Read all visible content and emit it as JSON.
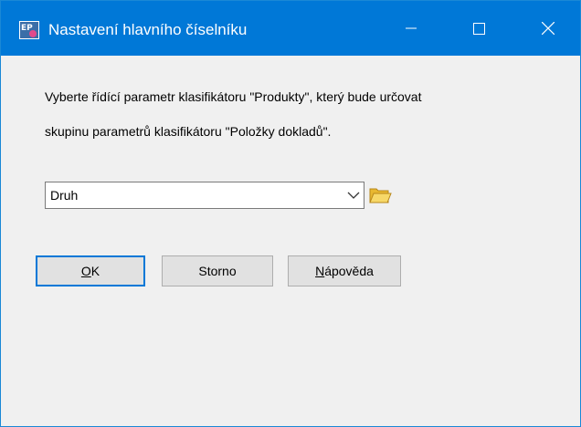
{
  "window": {
    "title": "Nastavení hlavního číselníku",
    "app_icon": "ep-app-icon",
    "controls": {
      "minimize_icon": "minimize-icon",
      "maximize_icon": "maximize-icon",
      "close_icon": "close-icon"
    },
    "titlebar_color": "#0078d7"
  },
  "content": {
    "description_line1": "Vyberte řídící parametr klasifikátoru \"Produkty\", který bude určovat",
    "description_line2": "skupinu parametrů klasifikátoru \"Položky dokladů\".",
    "combo": {
      "value": "Druh",
      "arrow_icon": "chevron-down-icon"
    },
    "browse_icon": "folder-icon"
  },
  "buttons": {
    "ok_mnemonic": "O",
    "ok_rest": "K",
    "storno": "Storno",
    "help_mnemonic": "N",
    "help_rest": "ápověda"
  },
  "colors": {
    "accent": "#0078d7",
    "background": "#f0f0f0",
    "folder": "#f3c94a"
  }
}
